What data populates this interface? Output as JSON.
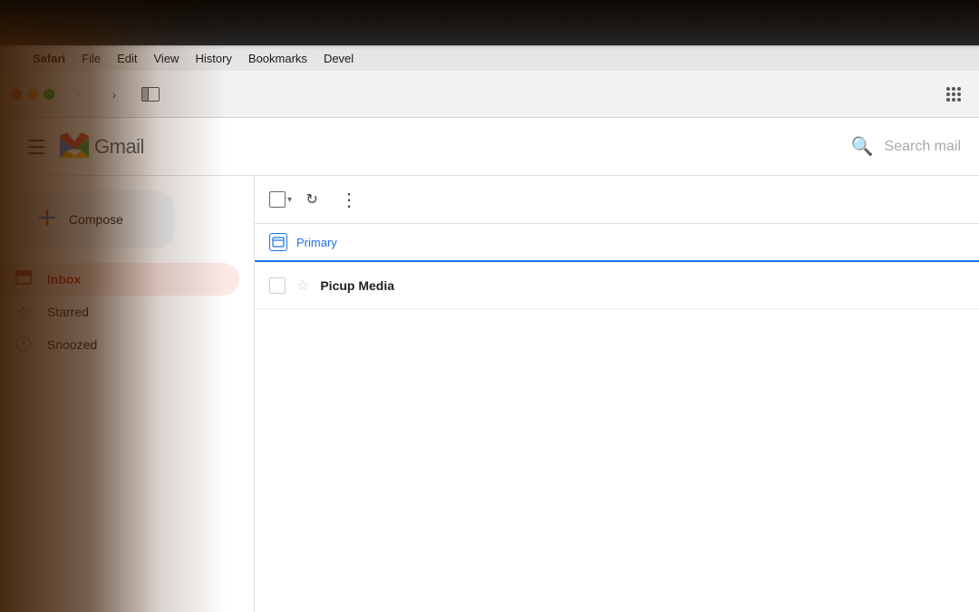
{
  "bg": {
    "description": "Warm bokeh background with orange/amber light"
  },
  "macbook": {
    "bezel_color": "#1a1a1a"
  },
  "menubar": {
    "apple_symbol": "",
    "items": [
      "Safari",
      "File",
      "Edit",
      "View",
      "History",
      "Bookmarks",
      "Devel"
    ]
  },
  "browser": {
    "back_btn": "‹",
    "forward_btn": "›",
    "grid_btn": "⊞"
  },
  "gmail": {
    "hamburger": "☰",
    "logo_text": "Gmail",
    "search_placeholder": "Search mail",
    "compose_label": "Compose",
    "sidebar_items": [
      {
        "label": "Inbox",
        "active": true
      },
      {
        "label": "Starred",
        "active": false
      },
      {
        "label": "Snoozed",
        "active": false
      }
    ],
    "toolbar": {
      "refresh_label": "↻",
      "more_label": "⋮"
    },
    "tabs": [
      {
        "label": "Primary",
        "active": true
      }
    ],
    "email_row": {
      "sender": "Picup Media",
      "star": "☆"
    }
  }
}
